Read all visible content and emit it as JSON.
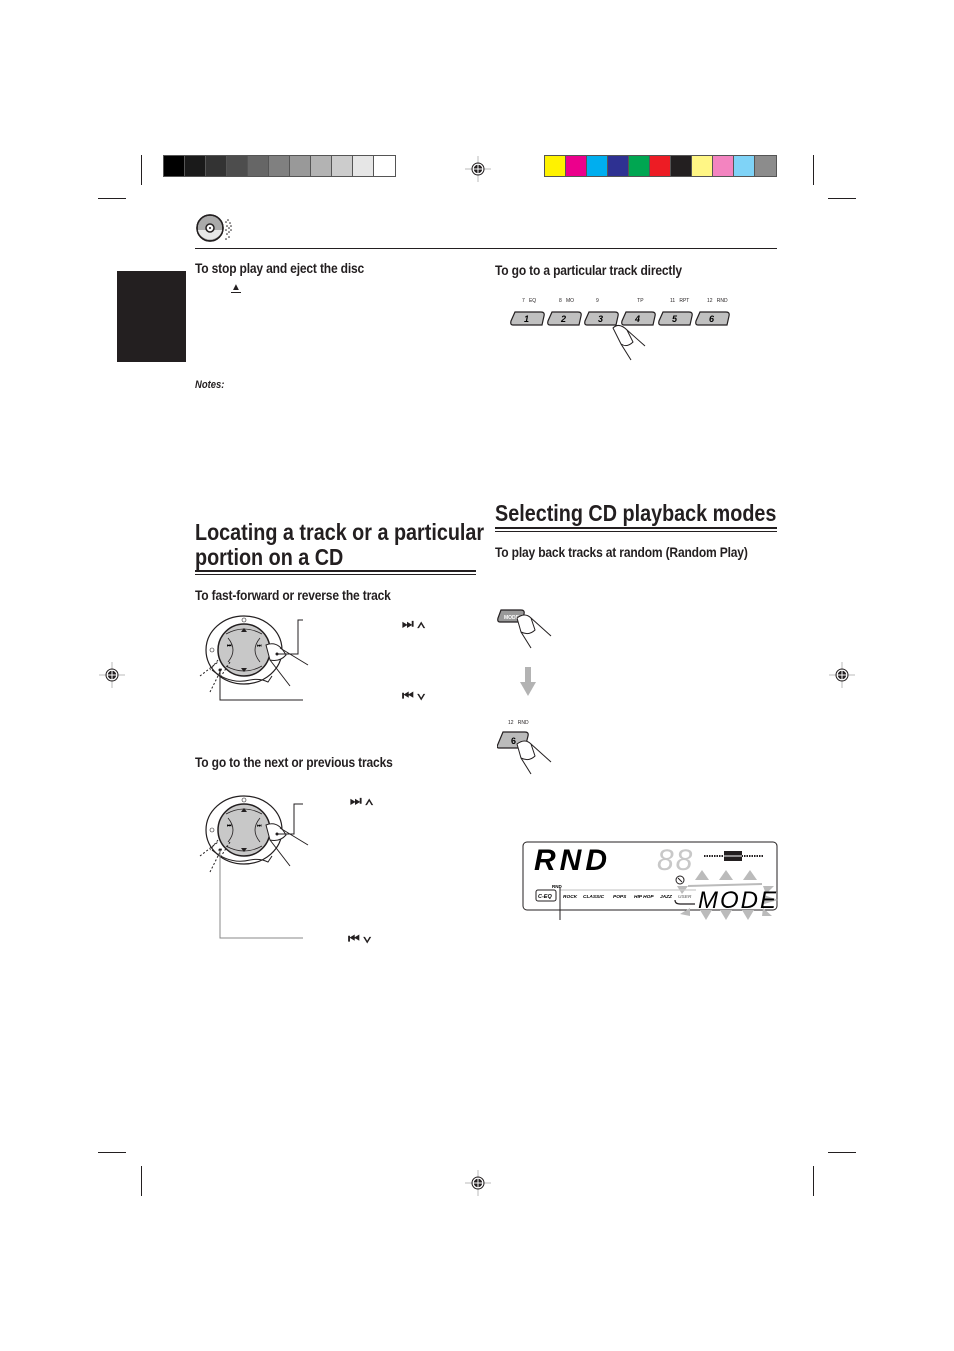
{
  "color_bars": {
    "grayscale": [
      "#000000",
      "#1a1a1a",
      "#333333",
      "#4d4d4d",
      "#666666",
      "#808080",
      "#999999",
      "#b3b3b3",
      "#cccccc",
      "#e6e6e6",
      "#ffffff"
    ],
    "process": [
      "#fff200",
      "#ec008c",
      "#00aeef",
      "#2e3192",
      "#00a651",
      "#ed1c24",
      "#231f20",
      "#fff685",
      "#f384c0",
      "#7fd3f7",
      "#8c8c8c"
    ]
  },
  "header": {
    "icon": "cd-disc-icon"
  },
  "left_column": {
    "stop_eject": {
      "heading": "To stop play and eject the disc",
      "eject_symbol": "▲"
    },
    "notes_label": "Notes:",
    "locating": {
      "title_line1": "Locating a track or a particular",
      "title_line2": "portion on a CD",
      "fast_forward": {
        "heading": "To fast-forward or reverse the track",
        "forward_symbols": "⏭ ∧",
        "reverse_symbols": "⏮ ∨"
      },
      "next_prev": {
        "heading": "To go to the next or previous tracks",
        "forward_symbols": "⏭ ∧",
        "reverse_symbols": "⏮ ∨"
      }
    }
  },
  "right_column": {
    "direct_track": {
      "heading": "To go to a particular track directly",
      "buttons": [
        {
          "number": "1",
          "top_num": "7",
          "top_label": "EQ"
        },
        {
          "number": "2",
          "top_num": "8",
          "top_label": "MO"
        },
        {
          "number": "3",
          "top_num": "9",
          "top_label": ""
        },
        {
          "number": "4",
          "top_num": "",
          "top_label": "TP"
        },
        {
          "number": "5",
          "top_num": "11",
          "top_label": "RPT"
        },
        {
          "number": "6",
          "top_num": "12",
          "top_label": "RND"
        }
      ]
    },
    "playback_modes": {
      "title": "Selecting CD playback modes",
      "random_heading": "To play back tracks at random (Random Play)",
      "mode_button_label": "MODE",
      "rnd_button": {
        "number": "6",
        "top_num": "12",
        "top_label": "RND"
      },
      "display": {
        "main_text": "RND",
        "digits": "88",
        "mode_text": "MODE",
        "indicator": "RND",
        "ceq_label": "C-EQ",
        "eq_modes": [
          "ROCK",
          "CLASSIC",
          "POPS",
          "HIP HOP",
          "JAZZ",
          "USER"
        ]
      }
    }
  }
}
